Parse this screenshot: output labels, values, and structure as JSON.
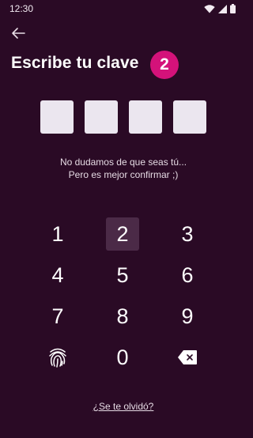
{
  "status_bar": {
    "time": "12:30"
  },
  "header": {
    "title": "Escribe tu clave",
    "step": "2"
  },
  "pin": {
    "length": 4,
    "filled": 0
  },
  "message": {
    "line1": "No dudamos de que seas tú...",
    "line2": "Pero es mejor confirmar ;)"
  },
  "keypad": {
    "keys": [
      "1",
      "2",
      "3",
      "4",
      "5",
      "6",
      "7",
      "8",
      "9",
      "",
      "0",
      ""
    ],
    "pressed_key": "2"
  },
  "forgot_link": "¿Se te olvidó?",
  "colors": {
    "background": "#2a0a25",
    "accent": "#d4127a",
    "pin_box": "#ebe6ef",
    "pressed_key": "#4b2a47"
  },
  "icons": [
    "back-arrow-icon",
    "wifi-icon",
    "cellular-signal-icon",
    "battery-icon",
    "fingerprint-icon",
    "backspace-icon"
  ]
}
